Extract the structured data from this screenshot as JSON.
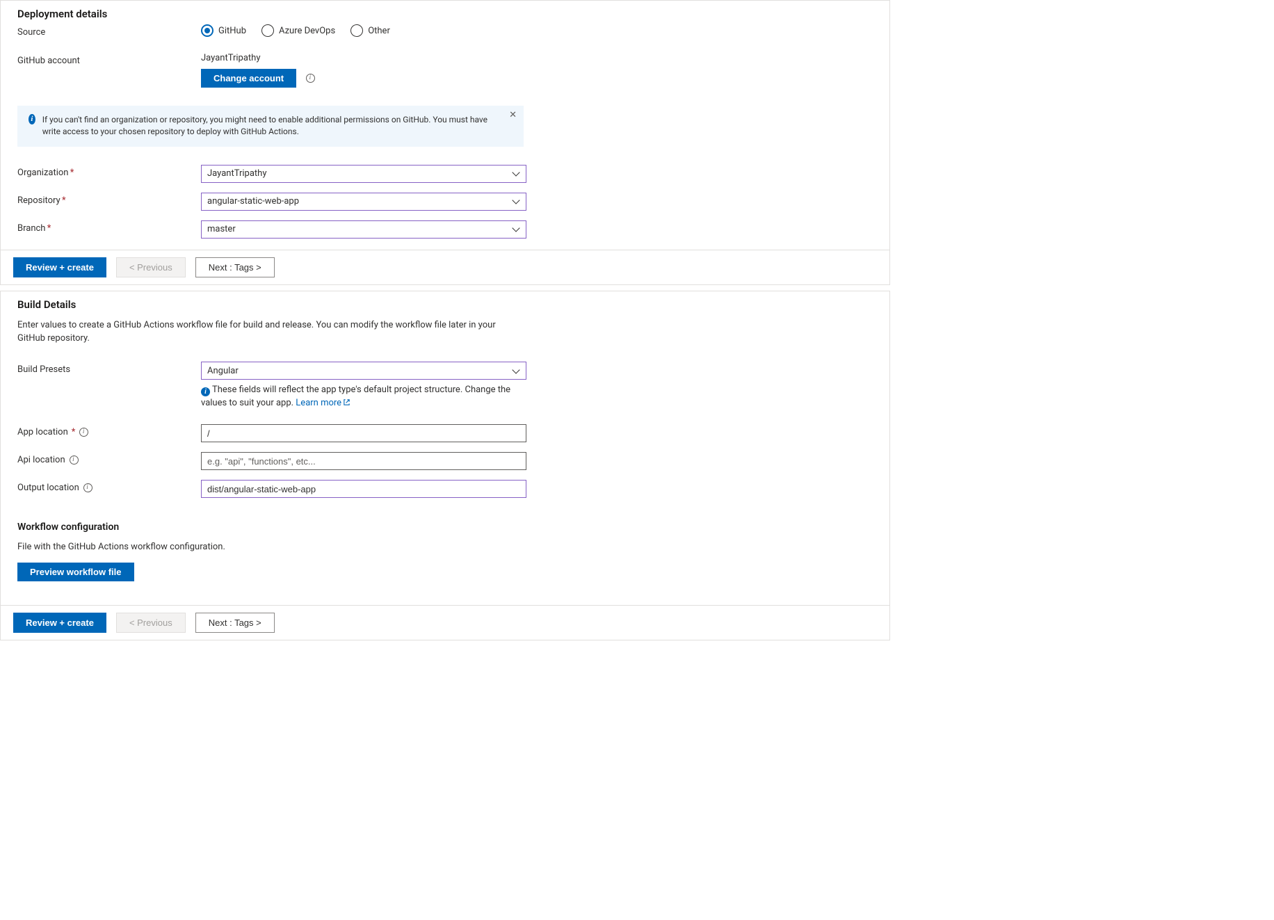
{
  "deployment": {
    "section_title": "Deployment details",
    "source_label": "Source",
    "source_options": [
      {
        "label": "GitHub",
        "selected": true
      },
      {
        "label": "Azure DevOps",
        "selected": false
      },
      {
        "label": "Other",
        "selected": false
      }
    ],
    "github_account_label": "GitHub account",
    "github_account_name": "JayantTripathy",
    "change_account_btn": "Change account",
    "info_message": "If you can't find an organization or repository, you might need to enable additional permissions on GitHub. You must have write access to your chosen repository to deploy with GitHub Actions.",
    "organization_label": "Organization",
    "organization_value": "JayantTripathy",
    "repository_label": "Repository",
    "repository_value": "angular-static-web-app",
    "branch_label": "Branch",
    "branch_value": "master"
  },
  "footer1": {
    "review_btn": "Review + create",
    "previous_btn": "< Previous",
    "next_btn": "Next : Tags >"
  },
  "build": {
    "section_title": "Build Details",
    "description": "Enter values to create a GitHub Actions workflow file for build and release. You can modify the workflow file later in your GitHub repository.",
    "presets_label": "Build Presets",
    "presets_value": "Angular",
    "presets_note": "These fields will reflect the app type's default project structure. Change the values to suit your app. ",
    "learn_more": "Learn more",
    "app_location_label": "App location",
    "app_location_value": "/",
    "api_location_label": "Api location",
    "api_location_placeholder": "e.g. \"api\", \"functions\", etc...",
    "output_location_label": "Output location",
    "output_location_value": "dist/angular-static-web-app",
    "workflow_title": "Workflow configuration",
    "workflow_desc": "File with the GitHub Actions workflow configuration.",
    "preview_btn": "Preview workflow file"
  },
  "footer2": {
    "review_btn": "Review + create",
    "previous_btn": "< Previous",
    "next_btn": "Next : Tags >"
  }
}
